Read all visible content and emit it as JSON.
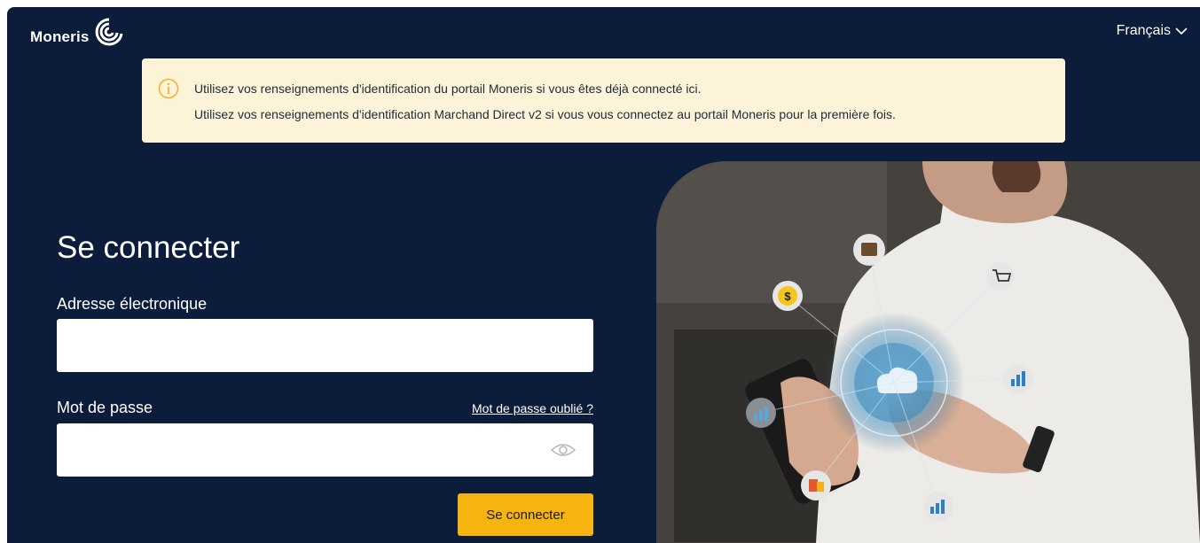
{
  "header": {
    "brand": "Moneris",
    "language": "Français"
  },
  "notice": {
    "line1": "Utilisez vos renseignements d'identification du portail Moneris si vous êtes déjà connecté ici.",
    "line2": "Utilisez vos renseignements d'identification Marchand Direct v2 si vous vous connectez au portail Moneris pour la première fois.",
    "icon": "info-icon"
  },
  "login": {
    "title": "Se connecter",
    "email_label": "Adresse électronique",
    "email_value": "",
    "password_label": "Mot de passe",
    "password_value": "",
    "forgot_link": "Mot de passe oublié ?",
    "submit_label": "Se connecter"
  },
  "colors": {
    "background": "#0b1d3a",
    "notice_bg": "#fdf3d8",
    "accent": "#f6b40e"
  }
}
